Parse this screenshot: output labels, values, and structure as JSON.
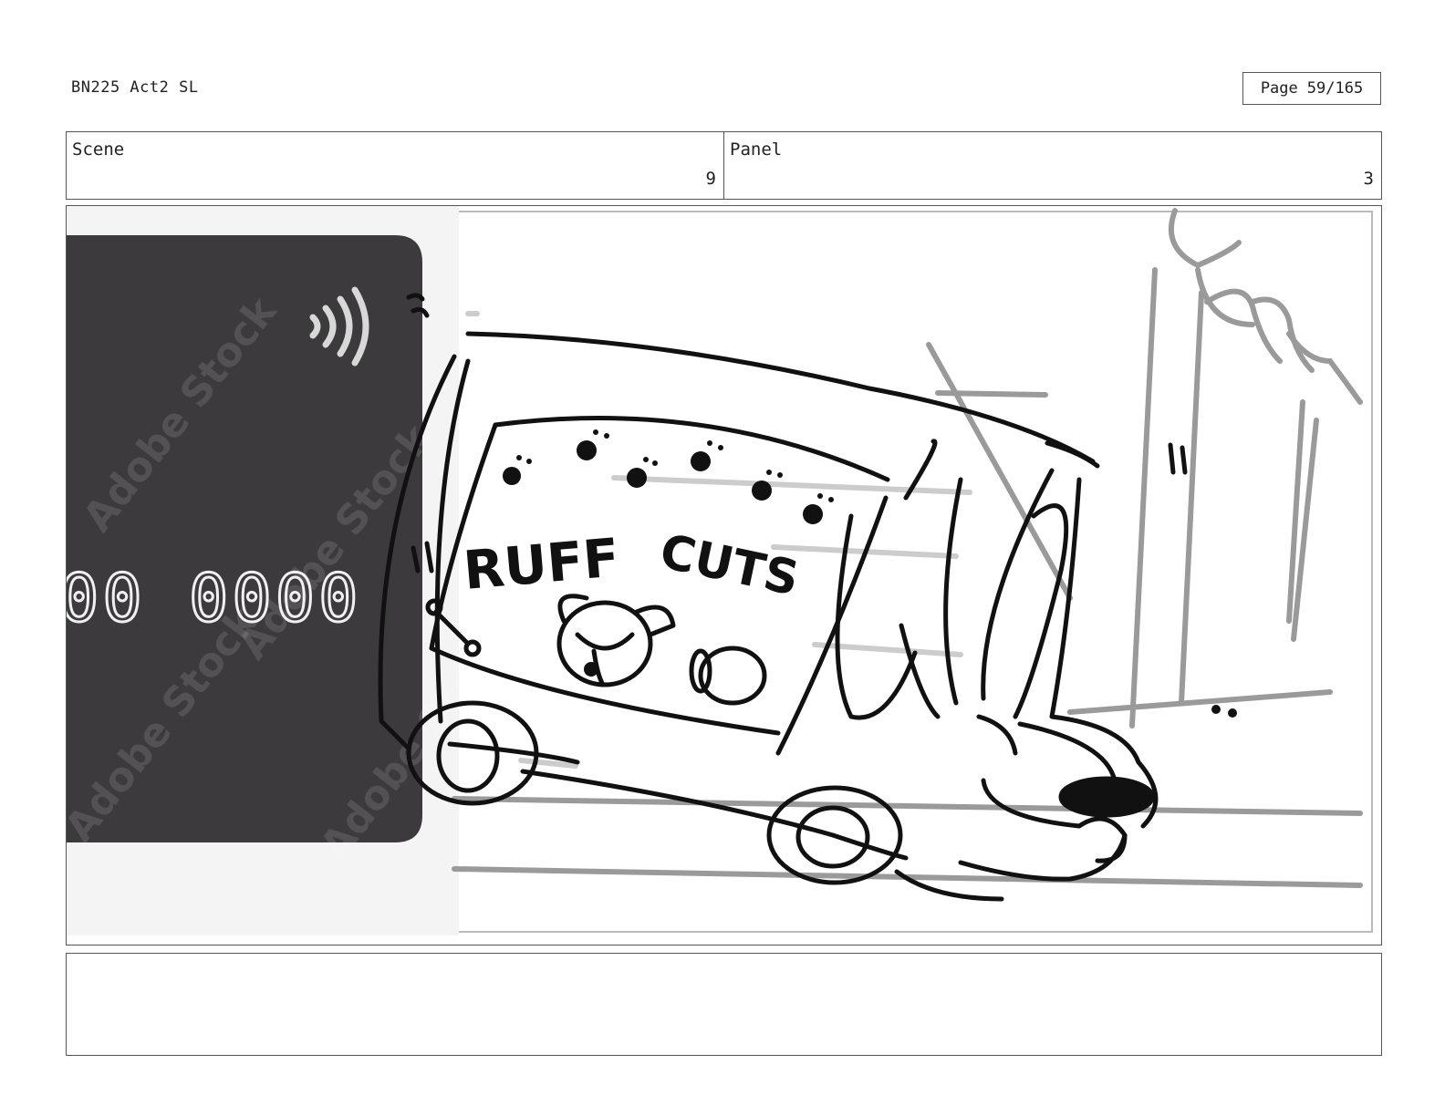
{
  "header": {
    "document_title": "BN225 Act2 SL",
    "page_label": "Page",
    "page_value": "59/165"
  },
  "info": {
    "scene_label": "Scene",
    "scene_value": "9",
    "panel_label": "Panel",
    "panel_value": "3"
  },
  "panel_art": {
    "card_number_fragment": "00 0000",
    "van_sign_line1": "RUFF",
    "van_sign_line2": "CUTS",
    "watermark_text": "Adobe Stock"
  },
  "notes": {
    "text": ""
  }
}
